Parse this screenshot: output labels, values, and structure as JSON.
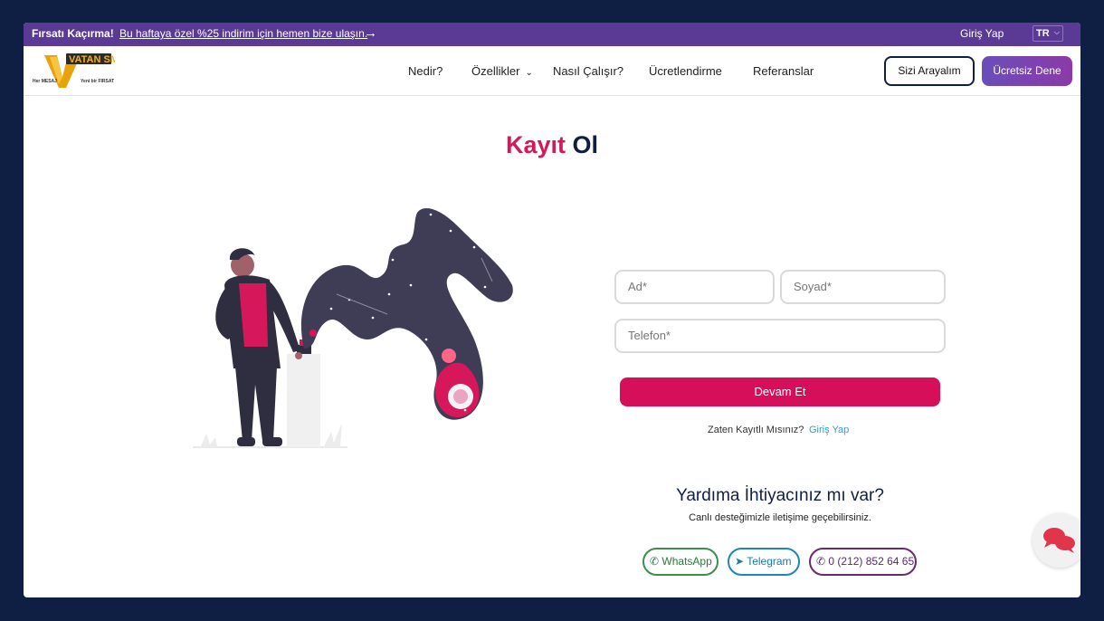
{
  "promo": {
    "headline": "Fırsatı Kaçırma!",
    "link_text": "Bu haftaya özel %25 indirim için hemen bize ulaşın.",
    "login": "Giriş Yap",
    "language": "TR"
  },
  "nav": {
    "items": [
      "Nedir?",
      "Özellikler",
      "Nasıl Çalışır?",
      "Ücretlendirme",
      "Referanslar"
    ],
    "call_button": "Sizi Arayalım",
    "try_button": "Ücretsiz Dene"
  },
  "logo": {
    "name": "VATAN SMS",
    "tagline_left": "Her MESAJ",
    "tagline_right": "Yeni bir FIRSAT"
  },
  "page": {
    "title_part1": "Kayıt",
    "title_part2": "Ol"
  },
  "form": {
    "first_name_placeholder": "Ad*",
    "last_name_placeholder": "Soyad*",
    "phone_placeholder": "Telefon*",
    "submit": "Devam Et",
    "have_account": "Zaten Kayıtlı Mısınız?",
    "login_link": "Giriş Yap"
  },
  "help": {
    "title": "Yardıma İhtiyacınız mı var?",
    "subtitle": "Canlı desteğimizle iletişime geçebilirsiniz.",
    "whatsapp": "WhatsApp",
    "telegram": "Telegram",
    "phone": "0 (212) 852 64 65"
  },
  "colors": {
    "accent": "#d6185b",
    "brand_dark": "#0f1f44",
    "promo_bar": "#5a3a95"
  }
}
